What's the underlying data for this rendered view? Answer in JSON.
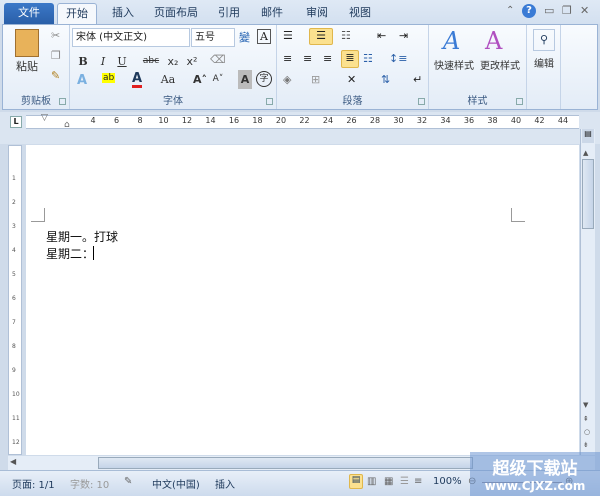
{
  "tabs": [
    "文件",
    "开始",
    "插入",
    "页面布局",
    "引用",
    "邮件",
    "审阅",
    "视图"
  ],
  "active_tab": "开始",
  "window_controls": {
    "help": "?"
  },
  "clipboard": {
    "paste": "粘贴",
    "label": "剪贴板"
  },
  "font": {
    "name": "宋体 (中文正文)",
    "size": "五号",
    "bold": "B",
    "italic": "I",
    "underline": "U",
    "strike": "abc",
    "subscript": "x₂",
    "superscript": "x²",
    "change_case": "Aa",
    "grow": "A˄",
    "shrink": "A˅",
    "shading": "A",
    "enclose": "字",
    "label": "字体"
  },
  "paragraph": {
    "label": "段落"
  },
  "styles": {
    "quick": "快速样式",
    "change": "更改样式",
    "label": "样式"
  },
  "editing": {
    "label": "编辑"
  },
  "ruler": {
    "ticks": [
      "4",
      "6",
      "8",
      "10",
      "12",
      "14",
      "16",
      "18",
      "20",
      "22",
      "24",
      "26",
      "28",
      "30",
      "32",
      "34",
      "36",
      "38",
      "40",
      "42",
      "44"
    ]
  },
  "document": {
    "lines": [
      "星期一。打球",
      "星期二："
    ]
  },
  "status": {
    "page": "页面: 1/1",
    "words": "字数: 10",
    "language": "中文(中国)",
    "mode": "插入",
    "zoom": "100%"
  },
  "watermark": {
    "title": "超级下载站",
    "url": "www.CJXZ.com"
  }
}
